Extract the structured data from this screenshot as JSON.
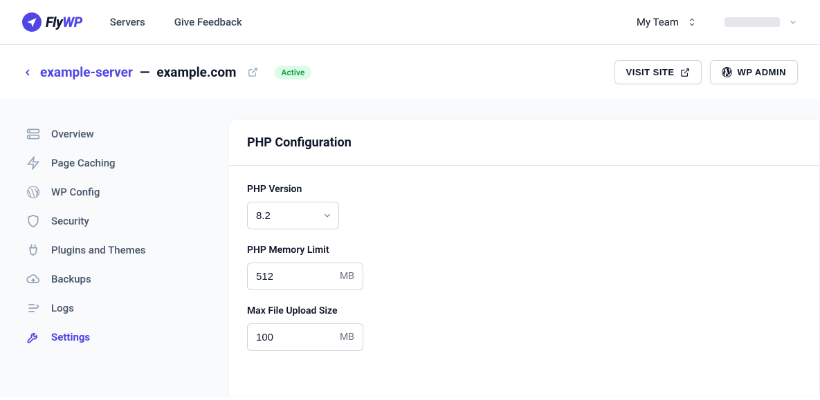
{
  "topnav": {
    "logo_fly": "Fly",
    "logo_wp": "WP",
    "links": {
      "servers": "Servers",
      "feedback": "Give Feedback"
    },
    "team_label": "My Team"
  },
  "subheader": {
    "server_name": "example-server",
    "dash": " — ",
    "domain": "example.com",
    "status": "Active",
    "visit_site": "VISIT SITE",
    "wp_admin": "WP ADMIN"
  },
  "sidebar": {
    "items": [
      {
        "label": "Overview"
      },
      {
        "label": "Page Caching"
      },
      {
        "label": "WP Config"
      },
      {
        "label": "Security"
      },
      {
        "label": "Plugins and Themes"
      },
      {
        "label": "Backups"
      },
      {
        "label": "Logs"
      },
      {
        "label": "Settings"
      }
    ]
  },
  "panel": {
    "title": "PHP Configuration",
    "php_version_label": "PHP Version",
    "php_version_value": "8.2",
    "mem_label": "PHP Memory Limit",
    "mem_value": "512",
    "mem_unit": "MB",
    "upload_label": "Max File Upload Size",
    "upload_value": "100",
    "upload_unit": "MB"
  }
}
